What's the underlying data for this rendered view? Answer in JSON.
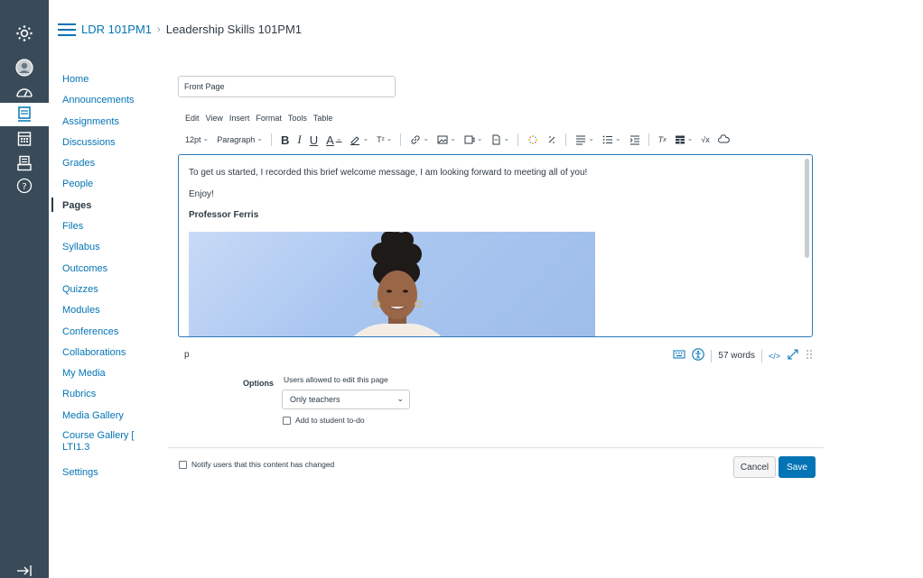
{
  "header": {
    "course_code": "LDR 101PM1",
    "separator": "›",
    "page_name": "Leadership Skills 101PM1"
  },
  "course_nav": {
    "items": [
      {
        "label": "Home"
      },
      {
        "label": "Announcements"
      },
      {
        "label": "Assignments"
      },
      {
        "label": "Discussions"
      },
      {
        "label": "Grades"
      },
      {
        "label": "People"
      },
      {
        "label": "Pages"
      },
      {
        "label": "Files"
      },
      {
        "label": "Syllabus"
      },
      {
        "label": "Outcomes"
      },
      {
        "label": "Quizzes"
      },
      {
        "label": "Modules"
      },
      {
        "label": "Conferences"
      },
      {
        "label": "Collaborations"
      },
      {
        "label": "My Media"
      },
      {
        "label": "Rubrics"
      },
      {
        "label": "Media Gallery"
      },
      {
        "label": "Course Gallery [ LTI1.3"
      },
      {
        "label": "Settings"
      }
    ],
    "active": "Pages"
  },
  "editor": {
    "title_value": "Front Page",
    "menu": [
      "Edit",
      "View",
      "Insert",
      "Format",
      "Tools",
      "Table"
    ],
    "toolbar": {
      "font_size": "12pt",
      "block_format": "Paragraph",
      "superscript": "T²"
    },
    "content": {
      "line1": "To get us started, I recorded this brief welcome message, I am looking forward to meeting all of you!",
      "line2": "Enjoy!",
      "line3": "Professor Ferris"
    },
    "status": {
      "path": "p",
      "word_count": "57 words",
      "html_toggle": "</>"
    }
  },
  "options": {
    "label": "Options",
    "edit_permission_label": "Users allowed to edit this page",
    "edit_permission_value": "Only teachers",
    "todo_label": "Add to student to-do"
  },
  "footer": {
    "notify_label": "Notify users that this content has changed",
    "cancel_label": "Cancel",
    "save_label": "Save"
  },
  "colors": {
    "rail": "#394b58",
    "link": "#0374b5",
    "editor_focus": "#2b7abc"
  }
}
